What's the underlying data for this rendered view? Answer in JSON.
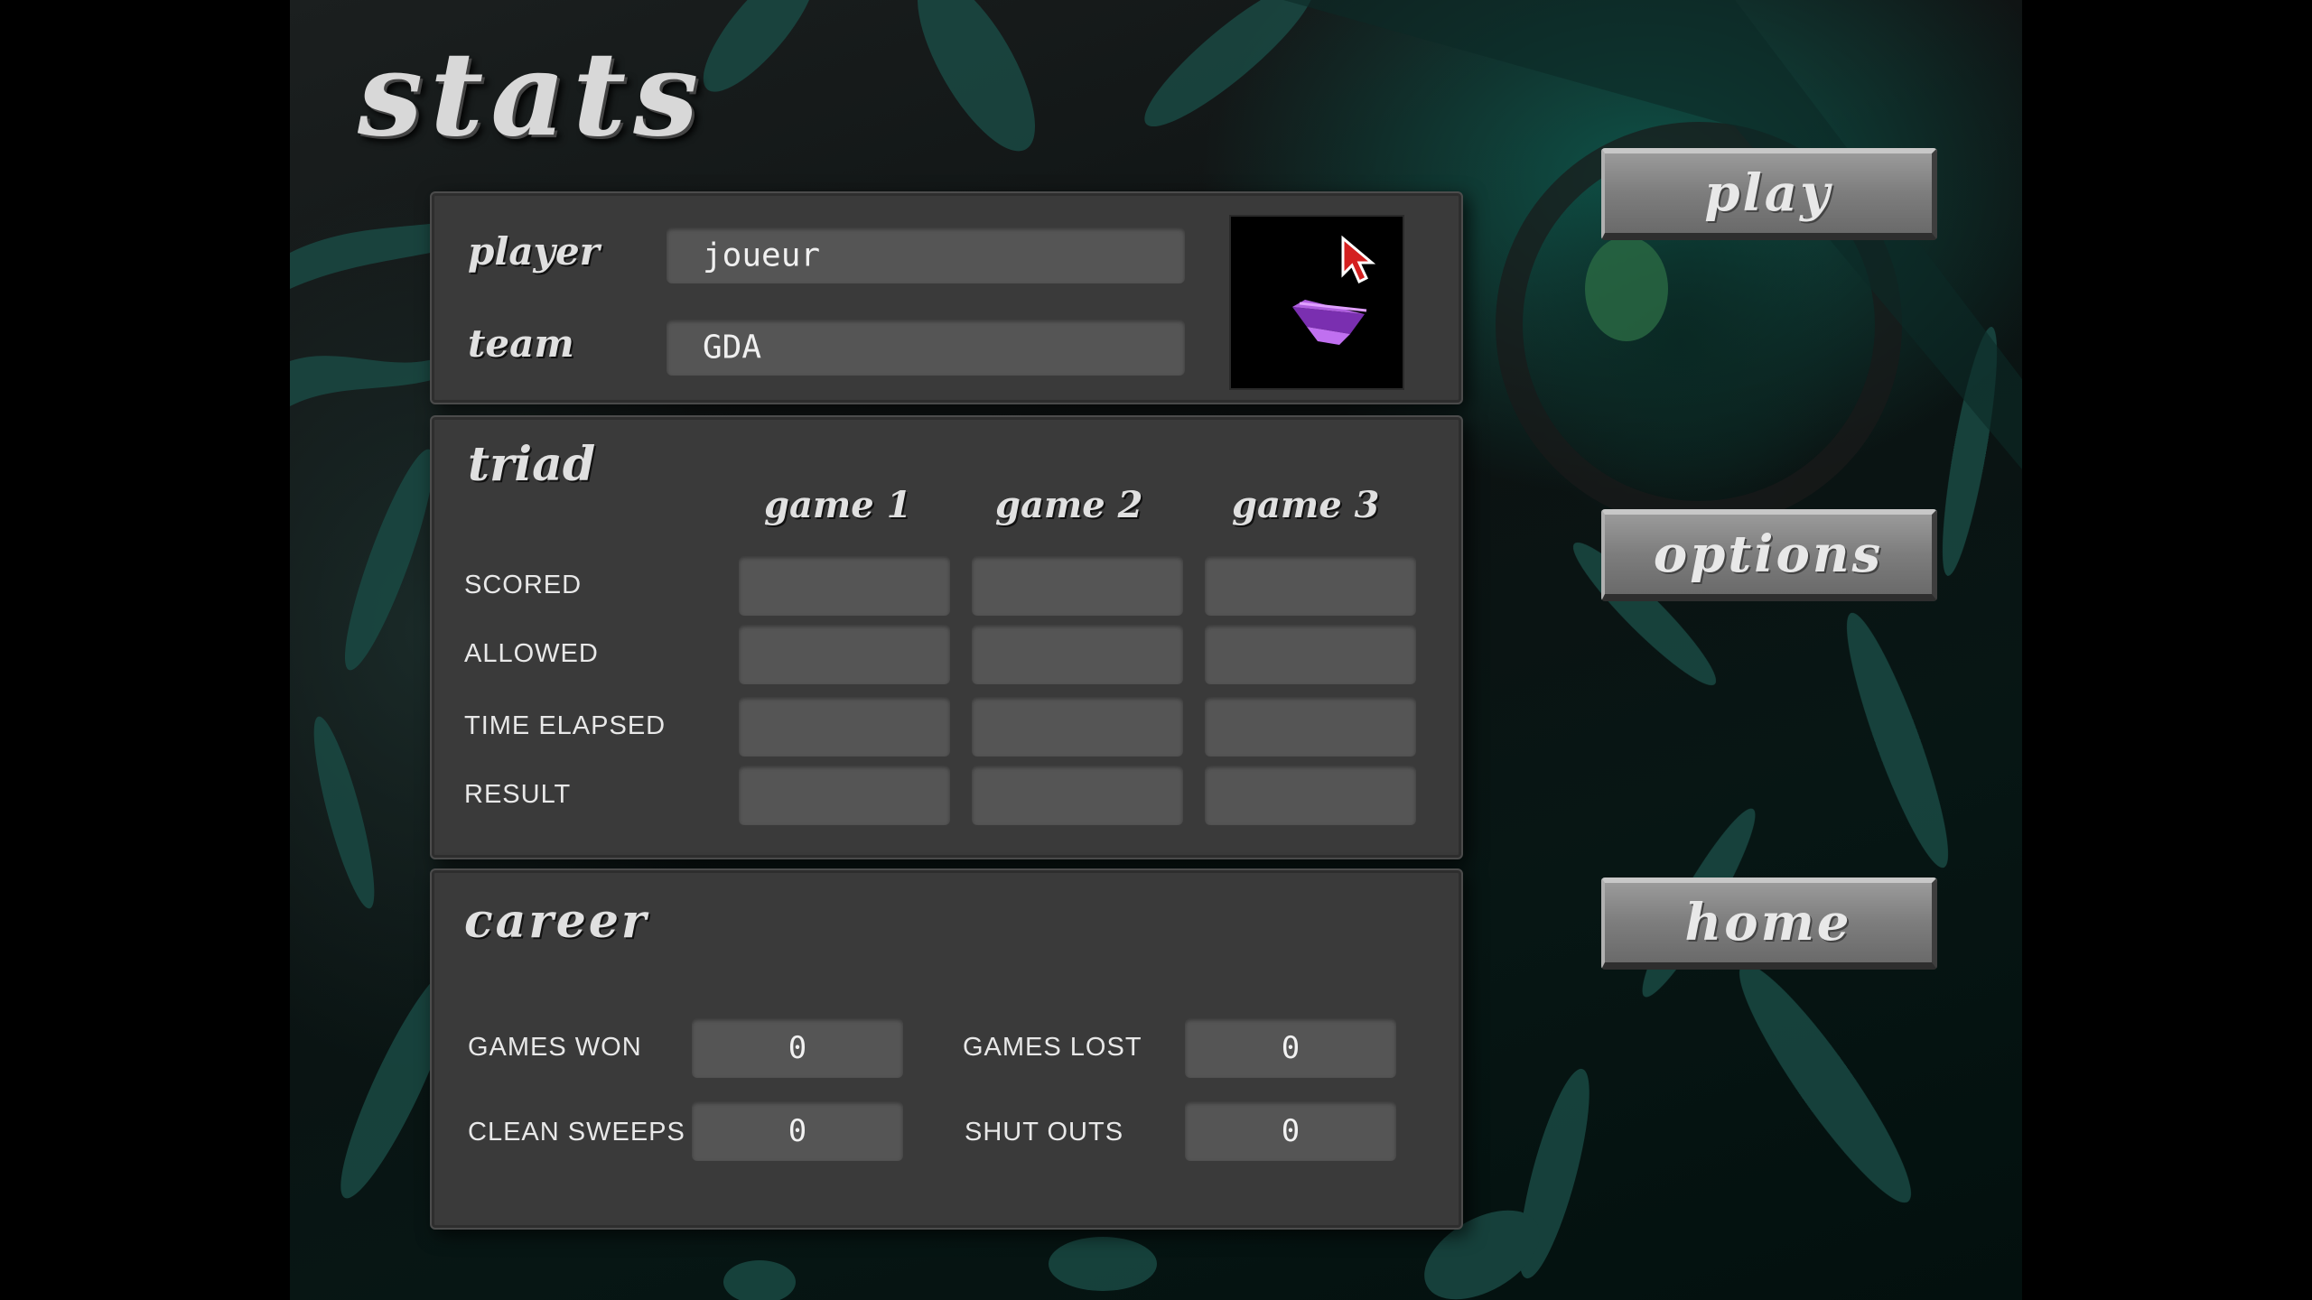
{
  "screen": {
    "title": "stats"
  },
  "player_panel": {
    "player_label": "player",
    "player_value": "joueur",
    "team_label": "team",
    "team_value": "GDA"
  },
  "triad": {
    "heading": "triad",
    "columns": [
      "game 1",
      "game 2",
      "game 3"
    ],
    "rows": [
      "SCORED",
      "ALLOWED",
      "TIME ELAPSED",
      "RESULT"
    ]
  },
  "career": {
    "heading": "career",
    "games_won_label": "GAMES WON",
    "games_won": "0",
    "games_lost_label": "GAMES LOST",
    "games_lost": "0",
    "clean_sweeps_label": "CLEAN SWEEPS",
    "clean_sweeps": "0",
    "shut_outs_label": "SHUT OUTS",
    "shut_outs": "0"
  },
  "menu": {
    "play": "play",
    "options": "options",
    "home": "home"
  },
  "colors": {
    "accent_teal": "#0f5248",
    "panel": "#3a3a3a",
    "field": "#555555",
    "logo_purple": "#9b4fd6",
    "cursor_red": "#d42020"
  }
}
